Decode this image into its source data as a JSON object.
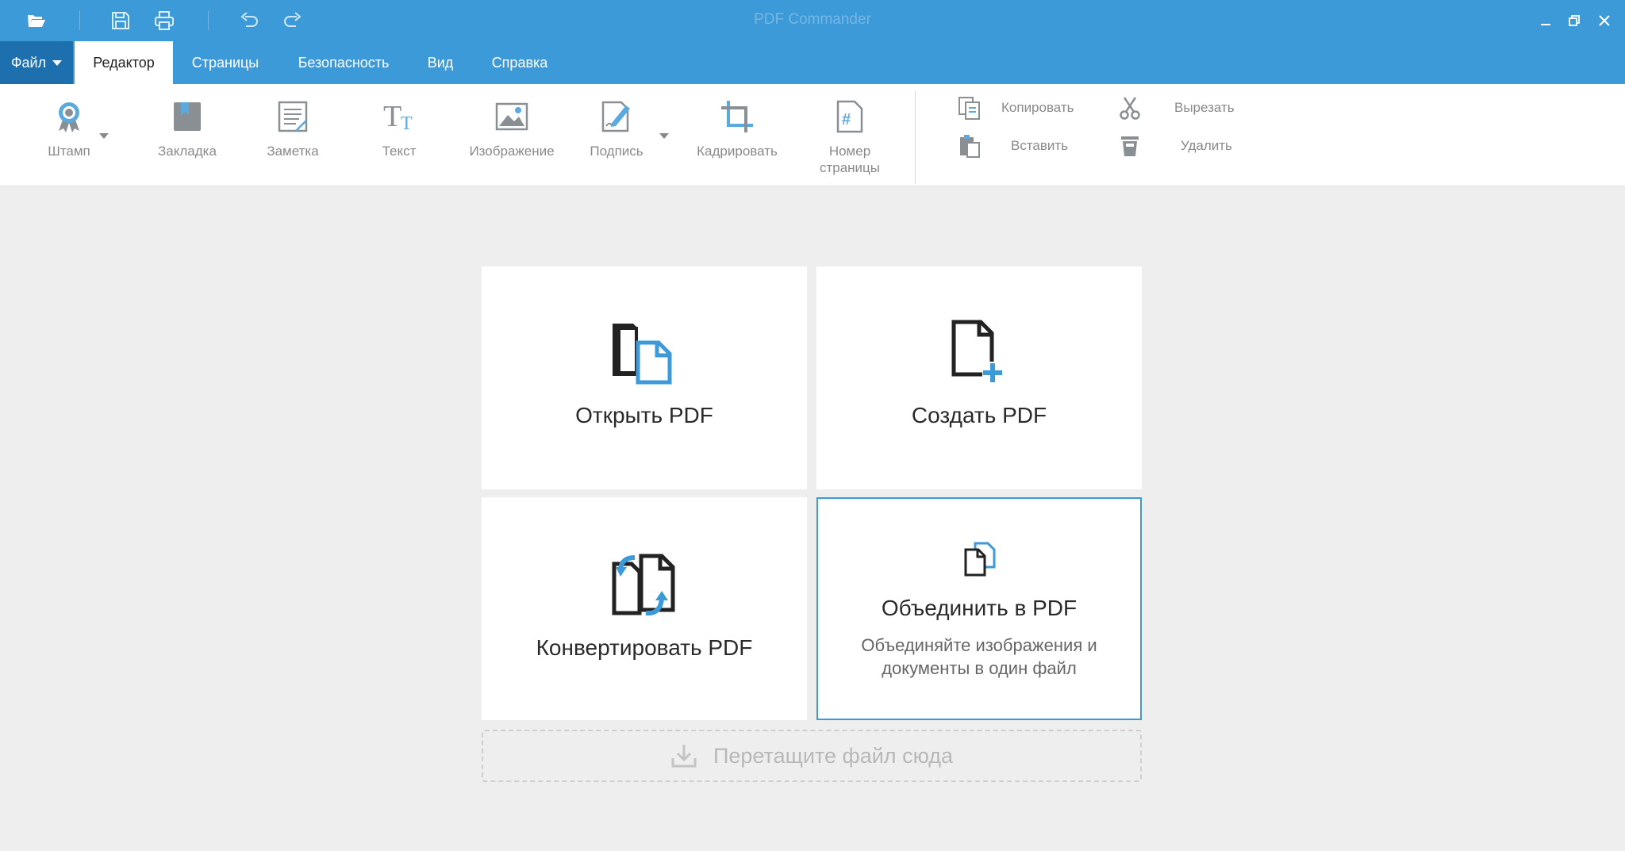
{
  "app": {
    "title": "PDF Commander"
  },
  "quick_access": {
    "icons": [
      "open-folder-icon",
      "save-icon",
      "print-icon",
      "undo-icon",
      "redo-icon"
    ]
  },
  "window_controls": {
    "icons": [
      "minimize-icon",
      "restore-icon",
      "close-icon"
    ]
  },
  "menu": {
    "tabs": [
      {
        "label": "Файл",
        "active": false,
        "has_dropdown": true
      },
      {
        "label": "Редактор",
        "active": true
      },
      {
        "label": "Страницы",
        "active": false
      },
      {
        "label": "Безопасность",
        "active": false
      },
      {
        "label": "Вид",
        "active": false
      },
      {
        "label": "Справка",
        "active": false
      }
    ]
  },
  "toolbar": {
    "tools": [
      {
        "label": "Штамп",
        "icon": "stamp-icon",
        "has_dropdown": true
      },
      {
        "label": "Закладка",
        "icon": "bookmark-icon"
      },
      {
        "label": "Заметка",
        "icon": "note-icon"
      },
      {
        "label": "Текст",
        "icon": "text-icon"
      },
      {
        "label": "Изображение",
        "icon": "image-icon"
      },
      {
        "label": "Подпись",
        "icon": "signature-icon",
        "has_dropdown": true
      },
      {
        "label": "Кадрировать",
        "icon": "crop-icon"
      },
      {
        "label": "Номер\nстраницы",
        "icon": "page-number-icon"
      }
    ],
    "clipboard": [
      {
        "label": "Копировать",
        "icon": "copy-icon"
      },
      {
        "label": "Вставить",
        "icon": "paste-icon"
      },
      {
        "label": "Вырезать",
        "icon": "cut-icon"
      },
      {
        "label": "Удалить",
        "icon": "delete-icon"
      }
    ]
  },
  "cards": [
    {
      "title": "Открыть PDF",
      "icon": "open-pdf-icon"
    },
    {
      "title": "Создать PDF",
      "icon": "create-pdf-icon"
    },
    {
      "title": "Конвертировать PDF",
      "icon": "convert-pdf-icon"
    },
    {
      "title": "Объединить в PDF",
      "description": "Объединяйте изображения и документы в один файл",
      "icon": "merge-pdf-icon",
      "highlighted": true
    }
  ],
  "dropzone": {
    "label": "Перетащите файл сюда",
    "icon": "download-icon"
  },
  "colors": {
    "accent": "#3d9ad8",
    "file_tab": "#1e6fae",
    "background": "#eeeeee"
  }
}
